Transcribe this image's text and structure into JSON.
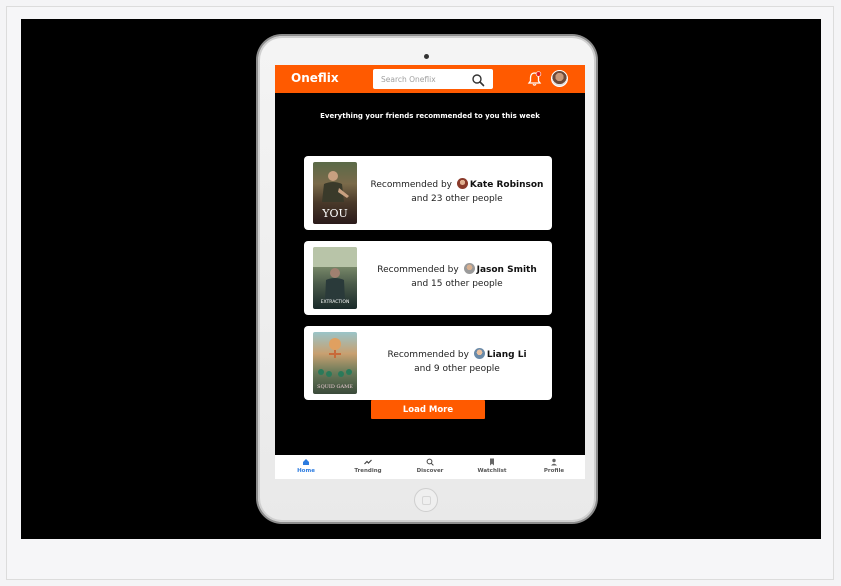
{
  "app": {
    "brand": "Oneflix",
    "search_placeholder": "Search Oneflix",
    "headline": "Everything  your friends recommended  to you this week"
  },
  "recommendations": [
    {
      "poster_title": "YOU",
      "prefix": "Recommended by",
      "name": "Kate Robinson",
      "others": "and 23 other people"
    },
    {
      "poster_title": "EXTRACTION",
      "prefix": "Recommended by",
      "name": "Jason Smith",
      "others": "and 15 other people"
    },
    {
      "poster_title": "SQUID GAME",
      "prefix": "Recommended by",
      "name": "Liang Li",
      "others": "and 9 other people"
    }
  ],
  "load_more_label": "Load More",
  "nav": [
    {
      "label": "Home",
      "icon": "home-icon",
      "active": true
    },
    {
      "label": "Trending",
      "icon": "trending-icon",
      "active": false
    },
    {
      "label": "Discover",
      "icon": "search-icon",
      "active": false
    },
    {
      "label": "Watchlist",
      "icon": "bookmark-icon",
      "active": false
    },
    {
      "label": "Profile",
      "icon": "user-icon",
      "active": false
    }
  ],
  "colors": {
    "accent": "#ff5a00",
    "nav_active": "#2b7be0",
    "screen_bg": "#000000"
  }
}
